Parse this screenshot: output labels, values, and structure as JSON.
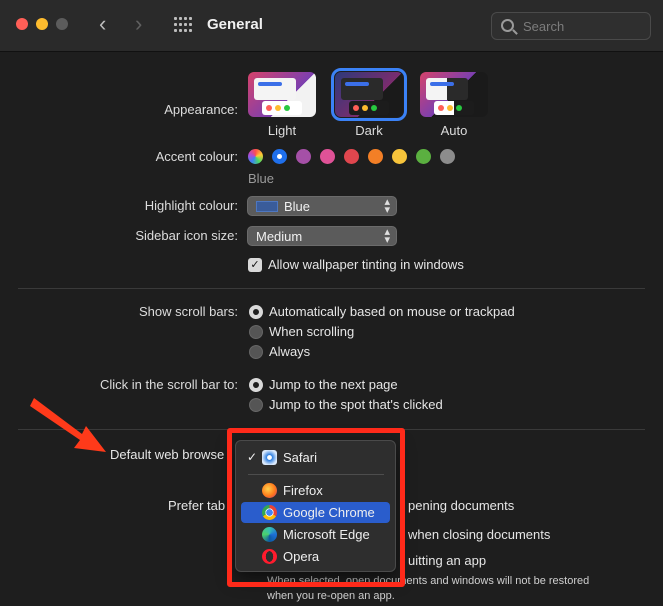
{
  "window": {
    "title": "General",
    "search_placeholder": "Search",
    "nav_back": "‹",
    "nav_forward": "›"
  },
  "appearance": {
    "label": "Appearance:",
    "options": [
      {
        "name": "Light",
        "selected": false
      },
      {
        "name": "Dark",
        "selected": true
      },
      {
        "name": "Auto",
        "selected": false
      }
    ]
  },
  "accent": {
    "label": "Accent colour:",
    "selected_name": "Blue",
    "colors": [
      "#9b59b6",
      "#1f6feb",
      "#a550a7",
      "#e05297",
      "#e0464e",
      "#f37f26",
      "#f7c43b",
      "#5bb040",
      "#8c8c8c"
    ]
  },
  "highlight": {
    "label": "Highlight colour:",
    "value": "Blue"
  },
  "sidebar_icon": {
    "label": "Sidebar icon size:",
    "value": "Medium"
  },
  "wallpaper_tinting": {
    "label": "Allow wallpaper tinting in windows",
    "checked": true
  },
  "scroll_bars": {
    "label": "Show scroll bars:",
    "options": [
      {
        "label": "Automatically based on mouse or trackpad",
        "selected": true
      },
      {
        "label": "When scrolling",
        "selected": false
      },
      {
        "label": "Always",
        "selected": false
      }
    ]
  },
  "click_scroll": {
    "label": "Click in the scroll bar to:",
    "options": [
      {
        "label": "Jump to the next page",
        "selected": true
      },
      {
        "label": "Jump to the spot that's clicked",
        "selected": false
      }
    ]
  },
  "default_browser": {
    "label": "Default web browse",
    "menu": [
      {
        "name": "Safari",
        "checked": true,
        "highlighted": false,
        "icon": "safari-icon"
      },
      {
        "name": "Firefox",
        "checked": false,
        "highlighted": false,
        "icon": "firefox-icon"
      },
      {
        "name": "Google Chrome",
        "checked": false,
        "highlighted": true,
        "icon": "chrome-icon"
      },
      {
        "name": "Microsoft Edge",
        "checked": false,
        "highlighted": false,
        "icon": "edge-icon"
      },
      {
        "name": "Opera",
        "checked": false,
        "highlighted": false,
        "icon": "opera-icon"
      }
    ]
  },
  "prefer_tabs": {
    "label": "Prefer tab",
    "suffix": "pening documents"
  },
  "ask_keep_changes": {
    "suffix": "when closing documents"
  },
  "close_windows": {
    "suffix": "uitting an app",
    "note_line1": "When selected, open documents and windows will not be restored",
    "note_line2": "when you re-open an app."
  },
  "annotation_color": "#ff2a1a"
}
